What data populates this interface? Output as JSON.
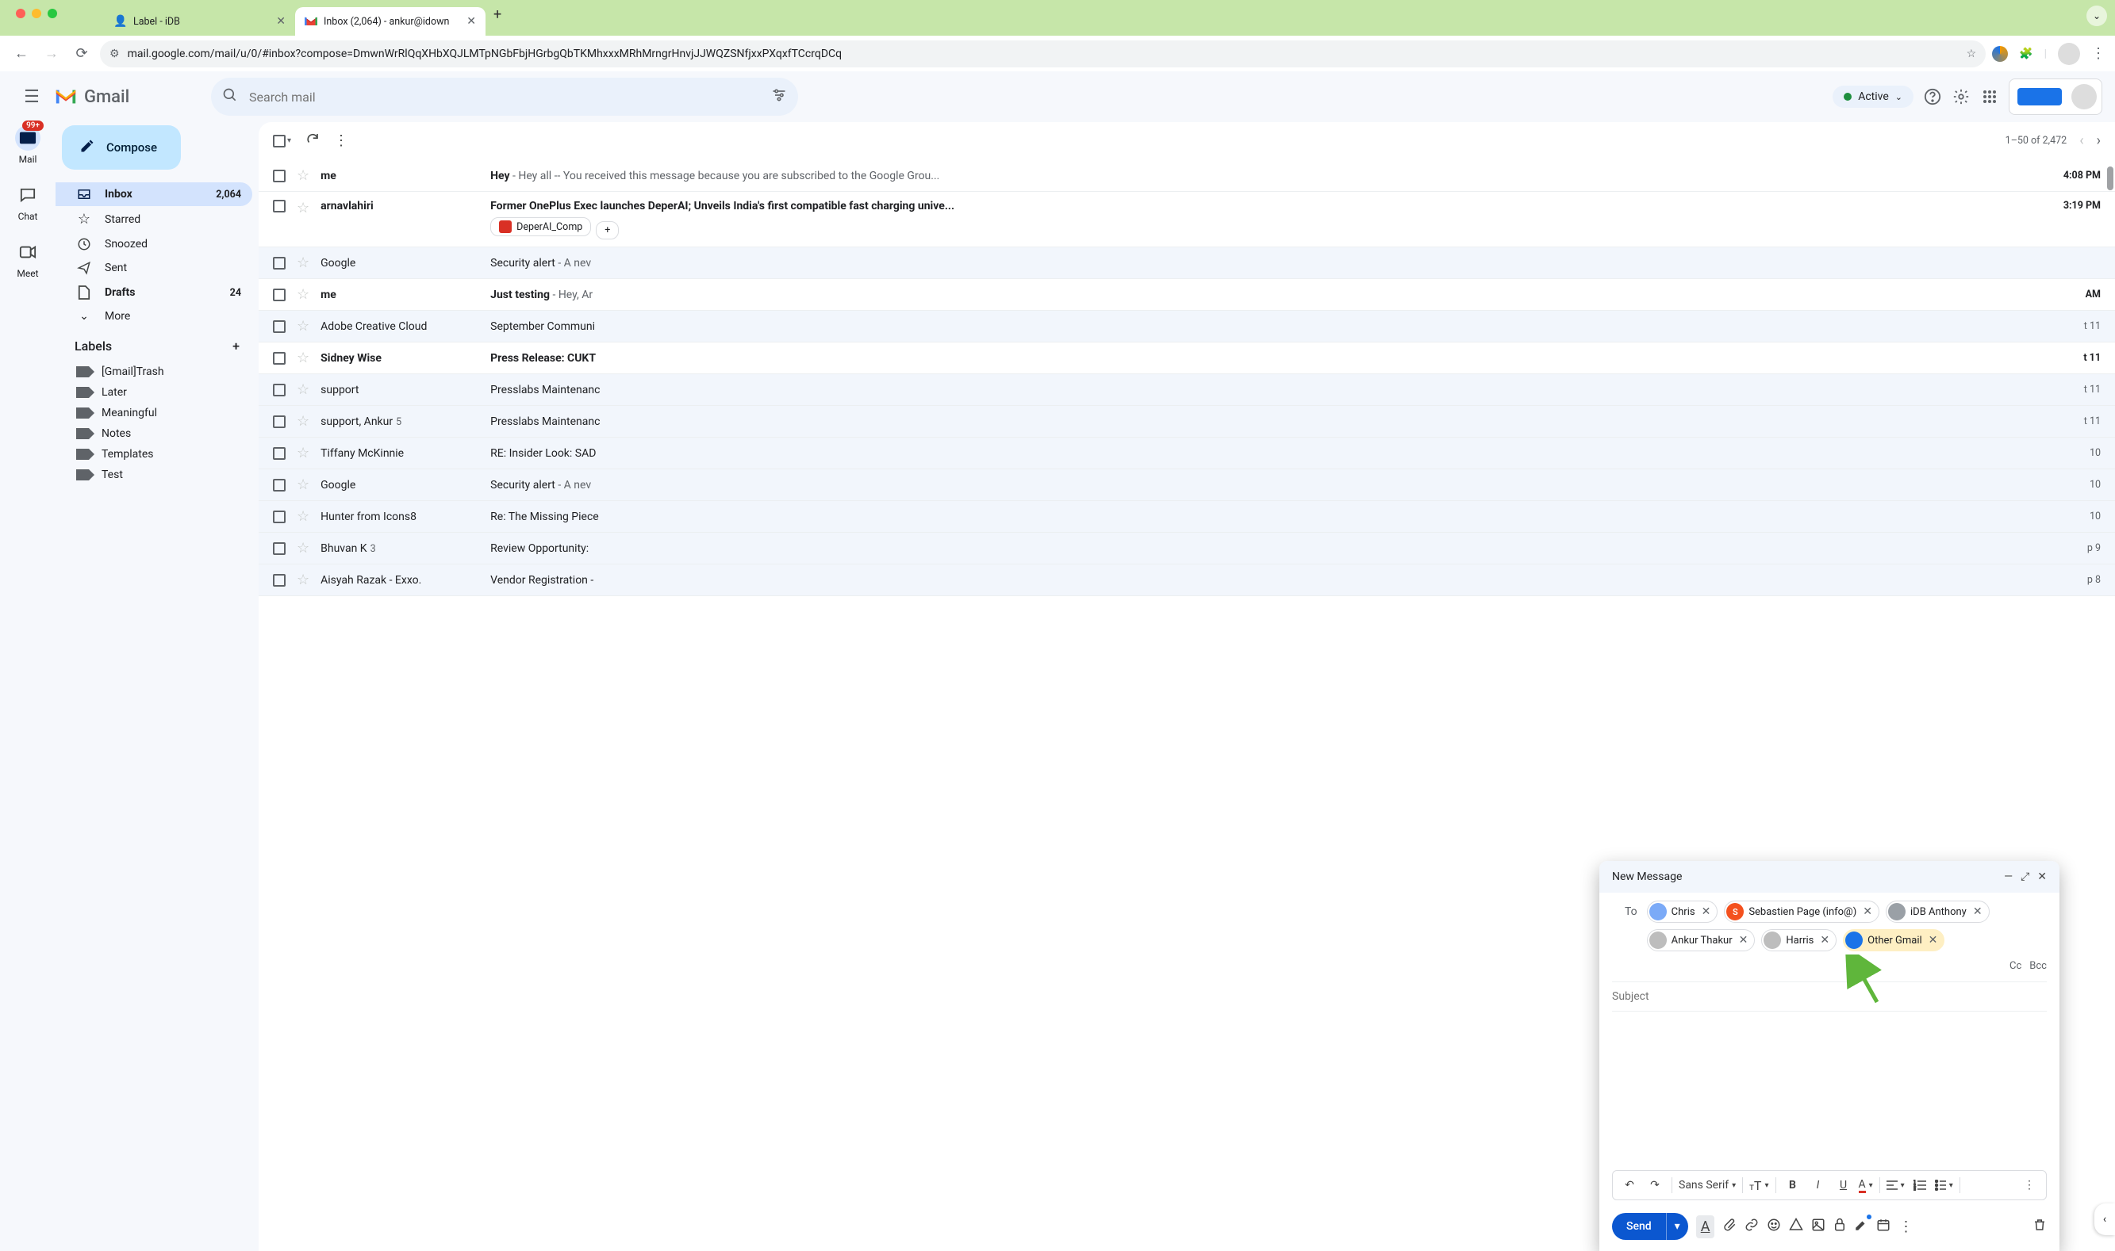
{
  "browser": {
    "tabs": [
      {
        "title": "Label - iDB",
        "active": false
      },
      {
        "title": "Inbox (2,064) - ankur@idown",
        "active": true
      }
    ],
    "url": "mail.google.com/mail/u/0/#inbox?compose=DmwnWrRlQqXHbXQJLMTpNGbFbjHGrbgQbTKMhxxxMRhMrngrHnvjJJWQZSNfjxxPXqxfTCcrqDCq"
  },
  "header": {
    "product": "Gmail",
    "search_placeholder": "Search mail",
    "status": "Active"
  },
  "rail": [
    {
      "label": "Mail",
      "badge": "99+",
      "selected": true
    },
    {
      "label": "Chat"
    },
    {
      "label": "Meet"
    }
  ],
  "compose_label": "Compose",
  "nav": [
    {
      "icon": "inbox",
      "label": "Inbox",
      "count": "2,064",
      "selected": true,
      "bold": true
    },
    {
      "icon": "star",
      "label": "Starred"
    },
    {
      "icon": "clock",
      "label": "Snoozed"
    },
    {
      "icon": "send",
      "label": "Sent"
    },
    {
      "icon": "file",
      "label": "Drafts",
      "count": "24",
      "bold": true
    },
    {
      "icon": "more",
      "label": "More"
    }
  ],
  "labels_header": "Labels",
  "labels": [
    {
      "label": "[Gmail]Trash"
    },
    {
      "label": "Later"
    },
    {
      "label": "Meaningful"
    },
    {
      "label": "Notes"
    },
    {
      "label": "Templates"
    },
    {
      "label": "Test"
    }
  ],
  "toolbar": {
    "range": "1–50 of 2,472"
  },
  "rows": [
    {
      "sender": "me",
      "subject": "Hey",
      "snippet": " - Hey all -- You received this message because you are subscribed to the Google Grou...",
      "time": "4:08 PM",
      "unread": true
    },
    {
      "sender": "arnavlahiri",
      "subject": "Former OnePlus Exec launches DeperAI; Unveils India's first compatible fast charging unive...",
      "snippet": "",
      "time": "3:19 PM",
      "unread": true,
      "attachments": [
        "DeperAI_Comp"
      ],
      "tall": true
    },
    {
      "sender": "Google",
      "subject": "Security alert",
      "snippet": " - A nev",
      "time": "",
      "unread": false
    },
    {
      "sender": "me",
      "subject": "Just testing",
      "snippet": " - Hey, Ar",
      "time": "AM",
      "unread": true
    },
    {
      "sender": "Adobe Creative Cloud",
      "subject": "September Communi",
      "snippet": "",
      "time": "t 11",
      "unread": false
    },
    {
      "sender": "Sidney Wise",
      "subject": "Press Release: CUKT",
      "snippet": "",
      "time": "t 11",
      "unread": true
    },
    {
      "sender": "support",
      "subject": "Presslabs Maintenanc",
      "snippet": "",
      "time": "t 11",
      "unread": false
    },
    {
      "sender": "support, Ankur",
      "thread_count": "5",
      "subject": "Presslabs Maintenanc",
      "snippet": "",
      "time": "t 11",
      "unread": false
    },
    {
      "sender": "Tiffany McKinnie",
      "subject": "RE: Insider Look: SAD",
      "snippet": "",
      "time": "10",
      "unread": false
    },
    {
      "sender": "Google",
      "subject": "Security alert",
      "snippet": " - A nev",
      "time": "10",
      "unread": false
    },
    {
      "sender": "Hunter from Icons8",
      "subject": "Re: The Missing Piece",
      "snippet": "",
      "time": "10",
      "unread": false
    },
    {
      "sender": "Bhuvan K",
      "thread_count": "3",
      "subject": "Review Opportunity:",
      "snippet": "",
      "time": "p 9",
      "unread": false
    },
    {
      "sender": "Aisyah Razak - Exxo.",
      "subject": "Vendor Registration -",
      "snippet": "",
      "time": "p 8",
      "unread": false
    }
  ],
  "compose": {
    "title": "New Message",
    "to_label": "To",
    "cc": "Cc",
    "bcc": "Bcc",
    "subject_placeholder": "Subject",
    "recipients": [
      {
        "name": "Chris",
        "color": "#7baaf7"
      },
      {
        "name": "Sebastien Page (info@)",
        "initial": "S",
        "color": "#f4511e"
      },
      {
        "name": "iDB Anthony",
        "color": "#9aa0a6"
      },
      {
        "name": "Ankur Thakur",
        "color": "#bdbdbd"
      },
      {
        "name": "Harris",
        "color": "#bdbdbd"
      },
      {
        "name": "Other Gmail",
        "color": "#1a73e8",
        "highlight": true
      }
    ],
    "font": "Sans Serif",
    "send": "Send"
  }
}
